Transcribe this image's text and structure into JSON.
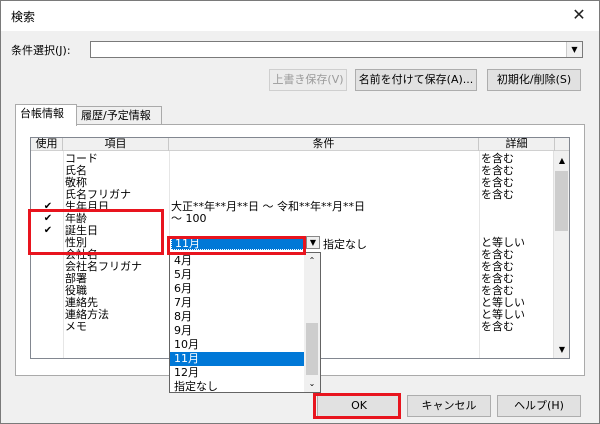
{
  "window": {
    "title": "検索",
    "close": "✕"
  },
  "condition_select": {
    "label": "条件選択(J):",
    "value": ""
  },
  "buttons": {
    "overwrite": "上書き保存(V)",
    "save_as": "名前を付けて保存(A)...",
    "reset": "初期化/削除(S)",
    "ok": "OK",
    "cancel": "キャンセル",
    "help": "ヘルプ(H)"
  },
  "tabs": [
    "台帳情報",
    "履歴/予定情報"
  ],
  "grid": {
    "headers": {
      "use": "使用",
      "item": "項目",
      "cond": "条件",
      "detail": "詳細"
    },
    "rows": [
      {
        "check": "",
        "item": "コード",
        "cond": "",
        "detail": "を含む"
      },
      {
        "check": "",
        "item": "氏名",
        "cond": "",
        "detail": "を含む"
      },
      {
        "check": "",
        "item": "敬称",
        "cond": "",
        "detail": "を含む"
      },
      {
        "check": "",
        "item": "氏名フリガナ",
        "cond": "",
        "detail": "を含む"
      },
      {
        "check": "✔",
        "item": "生年月日",
        "cond": "大正**年**月**日        ～   令和**年**月**日",
        "detail": ""
      },
      {
        "check": "✔",
        "item": "年齢",
        "cond": "                                   ～                                         100",
        "detail": ""
      },
      {
        "check": "✔",
        "item": "誕生日",
        "cond": "",
        "detail": ""
      },
      {
        "check": "",
        "item": "性別",
        "cond": "",
        "detail": "と等しい"
      },
      {
        "check": "",
        "item": "会社名",
        "cond": "",
        "detail": "を含む"
      },
      {
        "check": "",
        "item": "会社名フリガナ",
        "cond": "",
        "detail": "を含む"
      },
      {
        "check": "",
        "item": "部署",
        "cond": "",
        "detail": "を含む"
      },
      {
        "check": "",
        "item": "役職",
        "cond": "",
        "detail": "を含む"
      },
      {
        "check": "",
        "item": "連絡先",
        "cond": "",
        "detail": "と等しい"
      },
      {
        "check": "",
        "item": "連絡方法",
        "cond": "",
        "detail": "と等しい"
      },
      {
        "check": "",
        "item": "メモ",
        "cond": "",
        "detail": "を含む"
      }
    ],
    "birthday_month": "11月",
    "birthday_suffix": "指定なし"
  },
  "dropdown": {
    "options": [
      "4月",
      "5月",
      "6月",
      "7月",
      "8月",
      "9月",
      "10月",
      "11月",
      "12月",
      "指定なし"
    ],
    "selected": "11月"
  },
  "colors": {
    "highlight": "#0078d7",
    "annotation": "#e8141e"
  }
}
